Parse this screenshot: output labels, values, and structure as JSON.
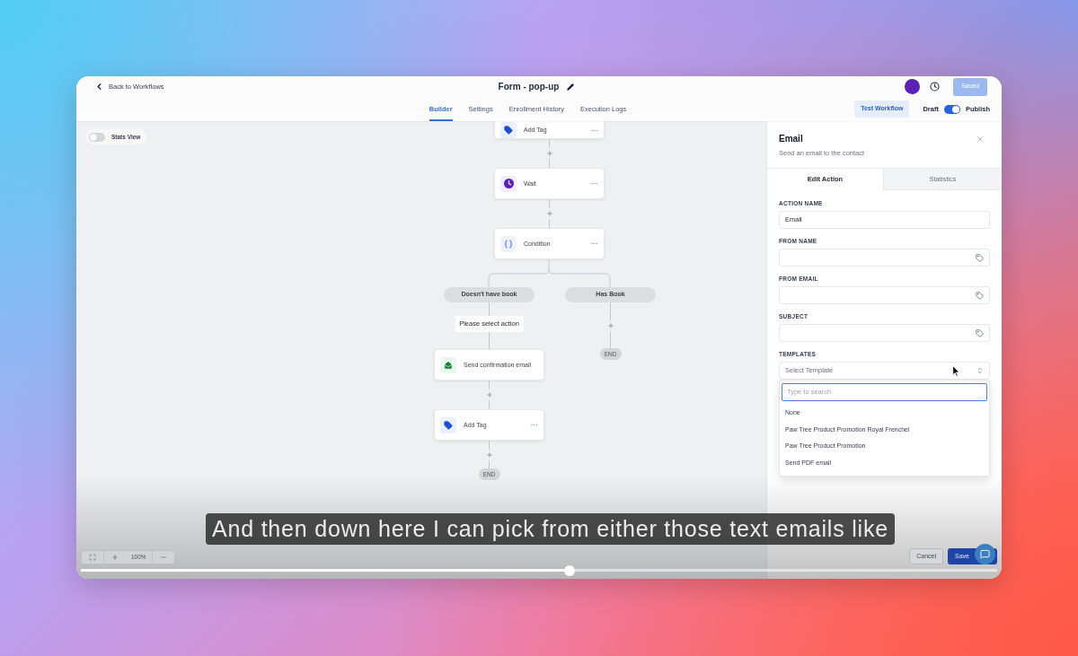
{
  "header": {
    "back_link": "Back to Workflows",
    "title": "Form - pop-up",
    "save_button": "Saved"
  },
  "tabs": [
    {
      "label": "Builder",
      "selected": true
    },
    {
      "label": "Settings",
      "selected": false
    },
    {
      "label": "Enrollment History",
      "selected": false
    },
    {
      "label": "Execution Logs",
      "selected": false
    }
  ],
  "toolbar": {
    "test_button": "Test Workflow",
    "draft_label": "Draft",
    "publish_toggle": {
      "on": true
    },
    "publish_label": "Publish"
  },
  "canvas": {
    "stats_view": {
      "label": "Stats View",
      "on": false
    },
    "nodes": [
      {
        "kind": "tag",
        "label": "Add Tag"
      },
      {
        "kind": "wait",
        "label": "Wait"
      },
      {
        "kind": "condition",
        "label": "Condition"
      }
    ],
    "branches": [
      {
        "label": "Doesn't have book",
        "note": "Please select action",
        "nodes": [
          {
            "kind": "email",
            "label": "Send confirmation email"
          },
          {
            "kind": "tag",
            "label": "Add Tag"
          }
        ],
        "end": "END"
      },
      {
        "label": "Has Book",
        "end": "END"
      }
    ],
    "zoom": "100%"
  },
  "panel": {
    "title": "Email",
    "subtitle": "Send an email to the contact",
    "tabs": [
      {
        "label": "Edit Action",
        "selected": true
      },
      {
        "label": "Statistics",
        "selected": false
      }
    ],
    "fields": [
      {
        "kind": "text",
        "label": "ACTION NAME",
        "value": "Email"
      },
      {
        "kind": "tag",
        "label": "FROM NAME"
      },
      {
        "kind": "tag",
        "label": "FROM EMAIL"
      },
      {
        "kind": "tag",
        "label": "SUBJECT"
      }
    ],
    "templates": {
      "label": "TEMPLATES",
      "placeholder": "Select Template",
      "expanded": true,
      "search_placeholder": "Type to search",
      "options": [
        "None",
        "Paw Tree Product Promotion Royal Frenchel",
        "Paw Tree Product Promotion",
        "Send PDF email"
      ]
    },
    "buttons": [
      "Cancel",
      "Save"
    ]
  },
  "video": {
    "caption": "And then down here I can pick from either those text emails like",
    "progress": {
      "level": 0.533
    }
  }
}
